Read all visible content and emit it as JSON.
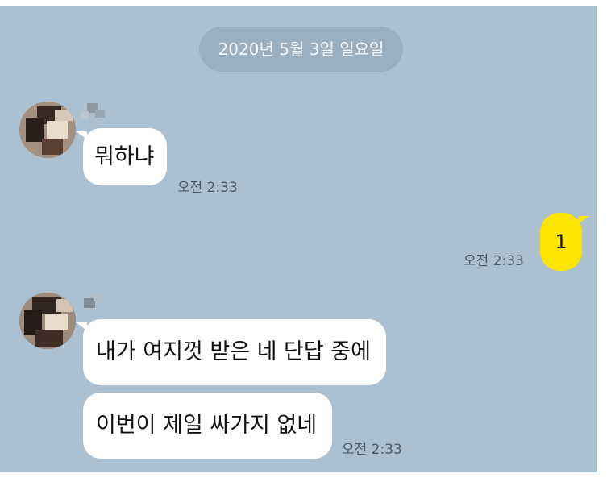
{
  "date_divider": "2020년 5월 3일 일요일",
  "messages": [
    {
      "sender": "other",
      "text": "뭐하냐",
      "time": "오전 2:33"
    },
    {
      "sender": "me",
      "text": "1",
      "time": "오전 2:33"
    },
    {
      "sender": "other",
      "text": "내가 여지껏 받은 네 단답 중에",
      "time": ""
    },
    {
      "sender": "other",
      "text": "이번이 제일 싸가지 없네",
      "time": "오전 2:33"
    }
  ],
  "colors": {
    "chat_background": "#abc1d1",
    "other_bubble": "#ffffff",
    "my_bubble": "#fde500"
  }
}
